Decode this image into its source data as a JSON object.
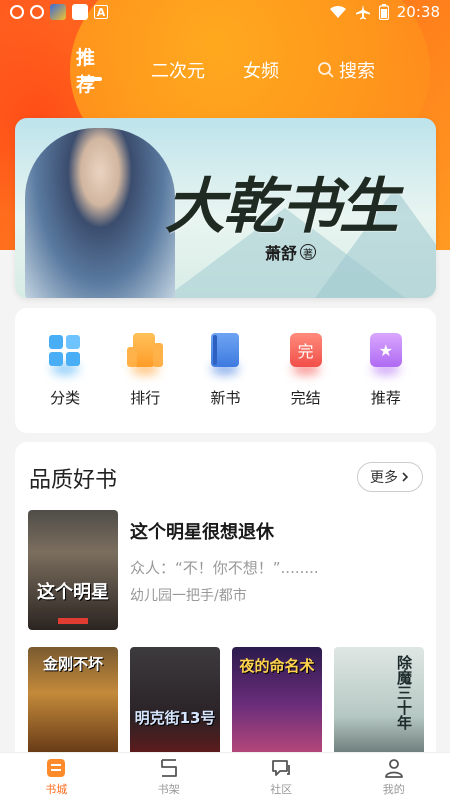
{
  "status_bar": {
    "time": "20:38"
  },
  "top_tabs": [
    {
      "label": "推荐",
      "active": true
    },
    {
      "label": "二次元"
    },
    {
      "label": "女频"
    },
    {
      "label": "搜索",
      "icon": "search-icon"
    }
  ],
  "banner": {
    "title": "大乾书生",
    "author": "萧舒",
    "author_badge": "著"
  },
  "quick_menu": [
    {
      "label": "分类",
      "icon": "category-icon"
    },
    {
      "label": "排行",
      "icon": "rank-icon"
    },
    {
      "label": "新书",
      "icon": "new-book-icon"
    },
    {
      "label": "完结",
      "icon": "finished-icon",
      "glyph": "完"
    },
    {
      "label": "推荐",
      "icon": "recommend-icon",
      "glyph": "★"
    }
  ],
  "quality": {
    "title": "品质好书",
    "more": "更多",
    "featured": {
      "title": "这个明星很想退休",
      "desc": "众人：“不！你不想！”........",
      "meta": "幼儿园一把手/都市",
      "cover_text": "这个明星"
    },
    "covers": [
      {
        "text": "金刚不坏"
      },
      {
        "text": "明克街13号"
      },
      {
        "text": "夜的命名术"
      },
      {
        "text": "除魔三十年"
      }
    ]
  },
  "bottom_nav": [
    {
      "label": "书城",
      "icon": "bookstore-icon",
      "active": true
    },
    {
      "label": "书架",
      "icon": "bookshelf-icon"
    },
    {
      "label": "社区",
      "icon": "community-icon"
    },
    {
      "label": "我的",
      "icon": "profile-icon"
    }
  ],
  "colors": {
    "brand": "#ff6d1f"
  }
}
